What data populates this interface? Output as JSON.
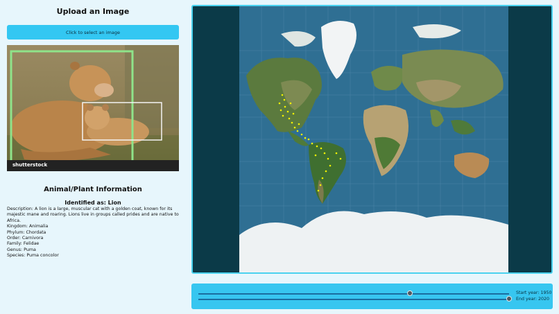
{
  "upload": {
    "title": "Upload an Image",
    "button_label": "Click to select an image",
    "watermark": "shutterstock"
  },
  "info": {
    "title": "Animal/Plant Information",
    "identified": "Identified as: Lion",
    "description": "Description: A lion is a large, muscular cat with a golden coat, known for its majestic mane and roaring. Lions live in groups called prides and are native to Africa.",
    "kingdom": "Kingdom: Animalia",
    "phylum": "Phylum: Chordata",
    "order": "Order: Carnivora",
    "family": "Family: Felidae",
    "genus": "Genus: Puma",
    "species": "Species: Puma concolor"
  },
  "sliders": {
    "start_label": "Start year: 1950",
    "end_label": "End year: 2020",
    "start_fraction": 0.68,
    "end_fraction": 1.0
  },
  "colors": {
    "accent": "#33c7f2",
    "map_bg": "#0b3a48",
    "ocean": "#2f6f93",
    "observation": "#f2f200"
  }
}
